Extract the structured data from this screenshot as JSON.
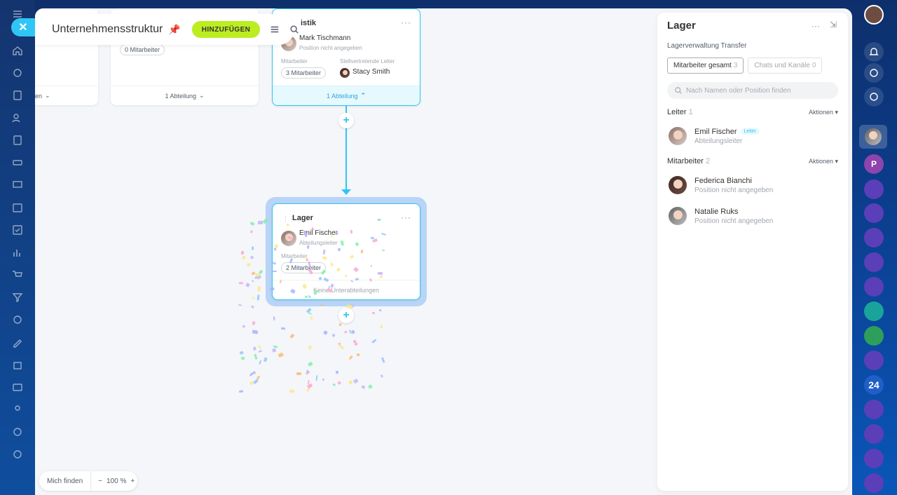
{
  "app": {
    "title": "Unternehmensstruktur",
    "add_label": "HINZUFÜGEN"
  },
  "cards": {
    "left_partial": {
      "footer": "en"
    },
    "second": {
      "employees": "0 Mitarbeiter",
      "footer": "1 Abteilung"
    },
    "logistik": {
      "title": "istik",
      "head_name": "Mark Tischmann",
      "head_pos": "Position nicht angegeben",
      "emp_label": "Mitarbeiter",
      "emp_count": "3 Mitarbeiter",
      "deputy_label": "Stellvertretende Leiter",
      "deputy_name": "Stacy Smith",
      "footer": "1 Abteilung"
    },
    "lager": {
      "title": "Lager",
      "head_name": "Emil Fischer",
      "head_pos": "Abteilungsleiter",
      "emp_label": "Mitarbeiter",
      "emp_count": "2 Mitarbeiter",
      "footer": "Keine Unterabteilungen"
    }
  },
  "find_me": {
    "label": "Mich finden",
    "zoom": "100 %"
  },
  "panel": {
    "title": "Lager",
    "subtitle": "Lagerverwaltung Transfer",
    "tabs": [
      {
        "label": "Mitarbeiter gesamt",
        "count": "3"
      },
      {
        "label": "Chats und Kanäle",
        "count": "0"
      }
    ],
    "search_placeholder": "Nach Namen oder Position finden",
    "leaders_title": "Leiter",
    "leaders_count": "1",
    "employees_title": "Mitarbeiter",
    "employees_count": "2",
    "actions_label": "Aktionen",
    "leader": {
      "name": "Emil Fischer",
      "badge": "Leiter",
      "position": "Abteilungsleiter"
    },
    "employees": [
      {
        "name": "Federica Bianchi",
        "position": "Position nicht angegeben"
      },
      {
        "name": "Natalie Ruks",
        "position": "Position nicht angegeben"
      }
    ]
  },
  "right_rail": {
    "badge_24": "24",
    "p_avatar": "P"
  },
  "colors": {
    "accent": "#2fc6f6",
    "add_button": "#bbed21"
  }
}
